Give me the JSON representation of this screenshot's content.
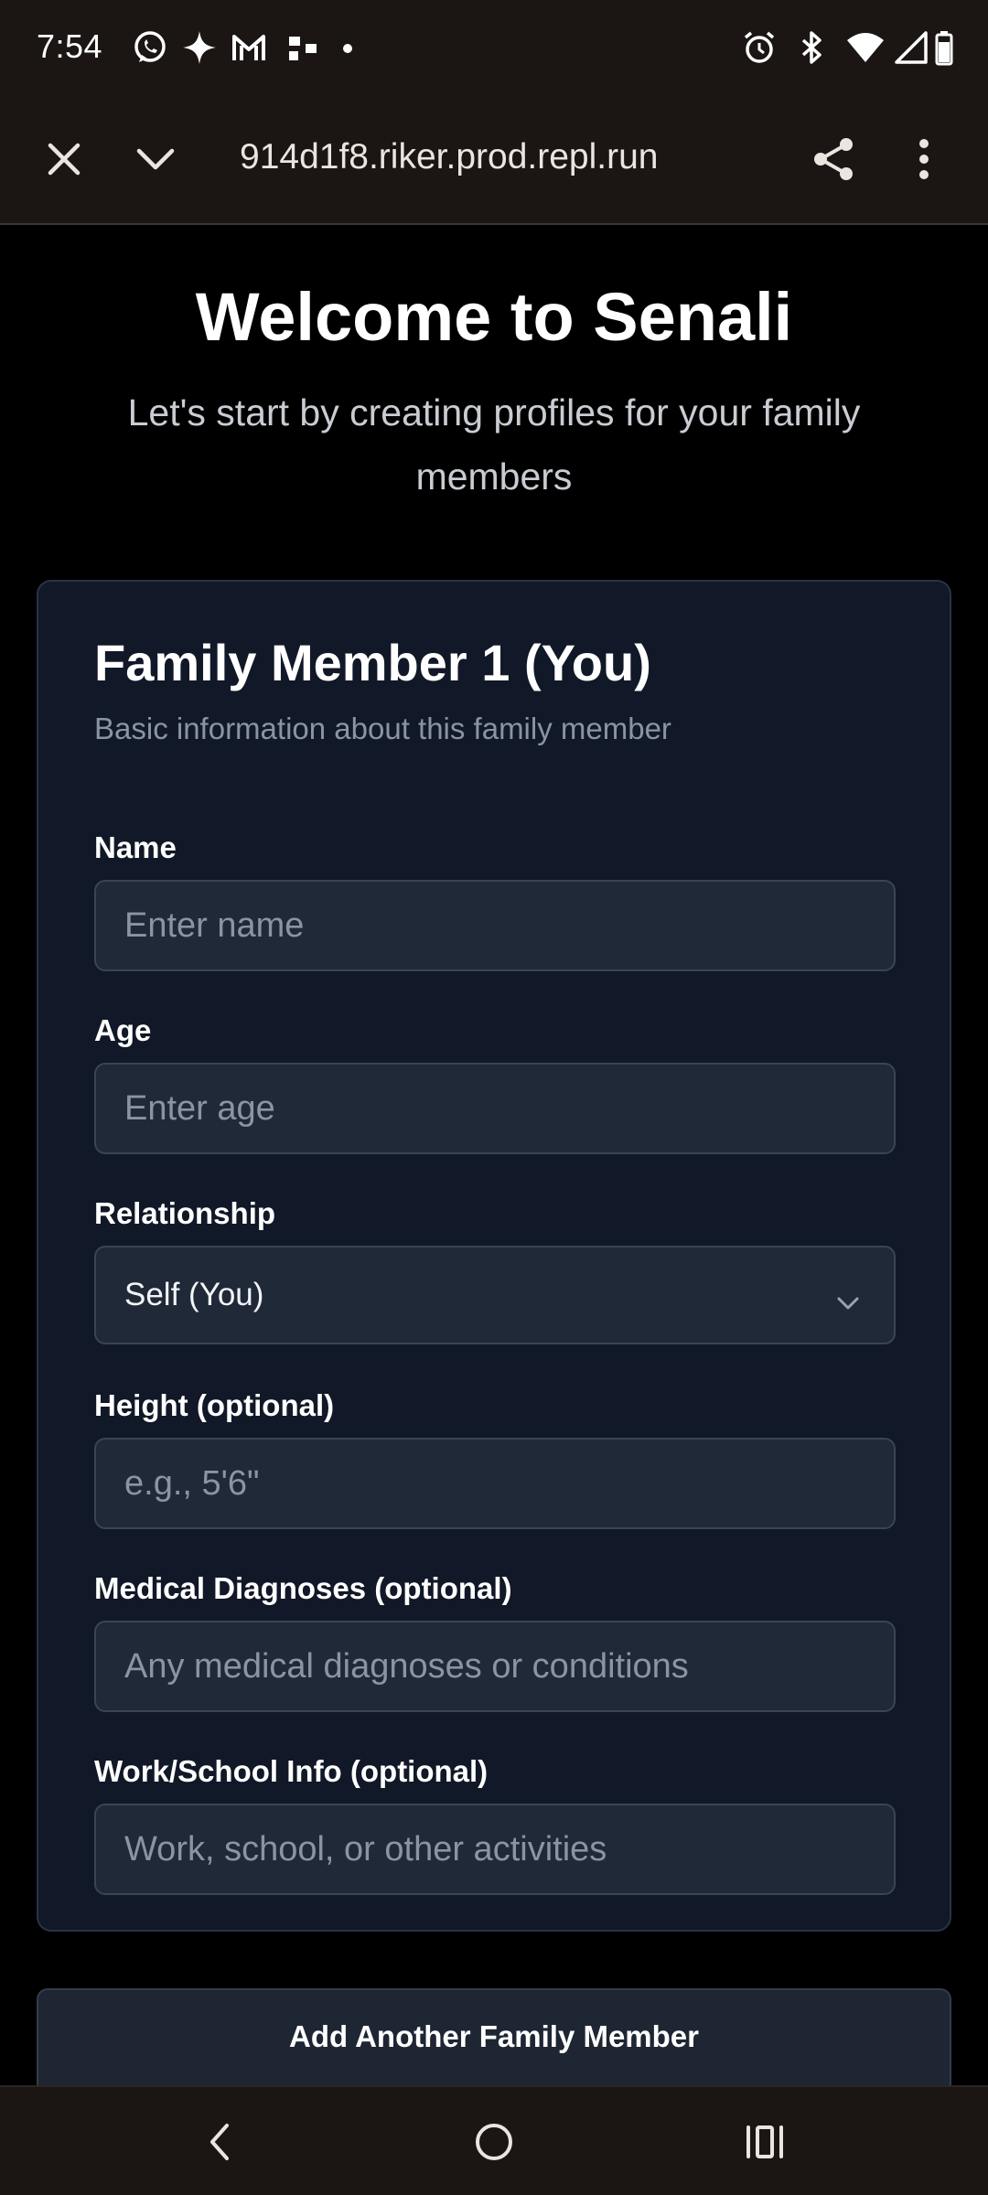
{
  "status_bar": {
    "time": "7:54",
    "left_icons": [
      "whatsapp-icon",
      "sparkle-icon",
      "gmail-icon",
      "slack-icon",
      "dot-icon"
    ],
    "right_icons": [
      "alarm-icon",
      "bluetooth-icon",
      "wifi-icon",
      "signal-icon",
      "battery-icon"
    ]
  },
  "browser": {
    "url": "914d1f8.riker.prod.repl.run",
    "close_icon": "close-icon",
    "collapse_icon": "chevron-down-icon",
    "share_icon": "share-icon",
    "menu_icon": "more-vert-icon"
  },
  "page": {
    "title": "Welcome to Senali",
    "subtitle": "Let's start by creating profiles for your family members",
    "logo_color": "#22c55e"
  },
  "form": {
    "card_title": "Family Member 1 (You)",
    "card_description": "Basic information about this family member",
    "name": {
      "label": "Name",
      "placeholder": "Enter name",
      "value": ""
    },
    "age": {
      "label": "Age",
      "placeholder": "Enter age",
      "value": ""
    },
    "relationship": {
      "label": "Relationship",
      "selected": "Self (You)"
    },
    "height": {
      "label": "Height (optional)",
      "placeholder": "e.g., 5'6\"",
      "value": ""
    },
    "medical": {
      "label": "Medical Diagnoses (optional)",
      "placeholder": "Any medical diagnoses or conditions",
      "value": ""
    },
    "work": {
      "label": "Work/School Info (optional)",
      "placeholder": "Work, school, or other activities",
      "value": ""
    }
  },
  "actions": {
    "add_member_label": "Add Another Family Member"
  },
  "nav": {
    "back_icon": "back-icon",
    "home_icon": "home-icon",
    "recents_icon": "recents-icon"
  },
  "colors": {
    "card_bg": "#111827",
    "input_bg": "#1f2937",
    "accent_green": "#22c55e"
  }
}
